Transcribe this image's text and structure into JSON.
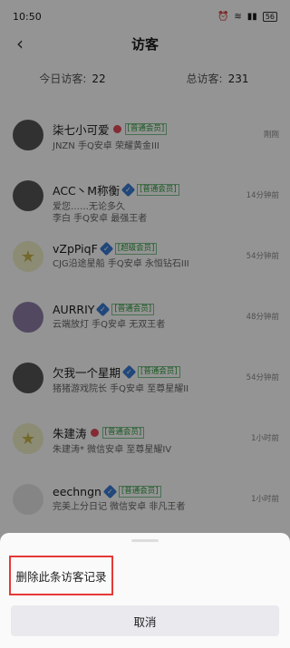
{
  "status_bar": {
    "time": "10:50",
    "battery": "56"
  },
  "nav": {
    "title": "访客"
  },
  "stats": {
    "today_label": "今日访客:",
    "today_value": "22",
    "total_label": "总访客:",
    "total_value": "231"
  },
  "visitors": [
    {
      "name": "柒七小可爱",
      "tag": "[普通会员]",
      "line1": "JNZN 手Q安卓 荣耀黄金III",
      "line2": "",
      "time": "刚刚"
    },
    {
      "name": "ACC丶M称衡",
      "tag": "[普通会员]",
      "line1": "爱您……无论多久",
      "line2": "李白 手Q安卓 最强王者",
      "time": "14分钟前"
    },
    {
      "name": "vZpPiqF",
      "tag": "[超级会员]",
      "line1": "CJG沿途星船 手Q安卓 永恒钻石III",
      "line2": "",
      "time": "54分钟前"
    },
    {
      "name": "AURRIY",
      "tag": "[普通会员]",
      "line1": "云端放灯 手Q安卓 无双王者",
      "line2": "",
      "time": "48分钟前"
    },
    {
      "name": "欠我一个星期",
      "tag": "[普通会员]",
      "line1": "猪猪游戏院长 手Q安卓 至尊星耀II",
      "line2": "",
      "time": "54分钟前"
    },
    {
      "name": "朱建涛",
      "tag": "[普通会员]",
      "line1": "朱建涛* 微信安卓 至尊星耀IV",
      "line2": "",
      "time": "1小时前"
    },
    {
      "name": "eechngn",
      "tag": "[普通会员]",
      "line1": "完美上分日记 微信安卓 非凡王者",
      "line2": "",
      "time": "1小时前"
    }
  ],
  "sheet": {
    "delete_label": "删除此条访客记录",
    "cancel_label": "取消"
  }
}
